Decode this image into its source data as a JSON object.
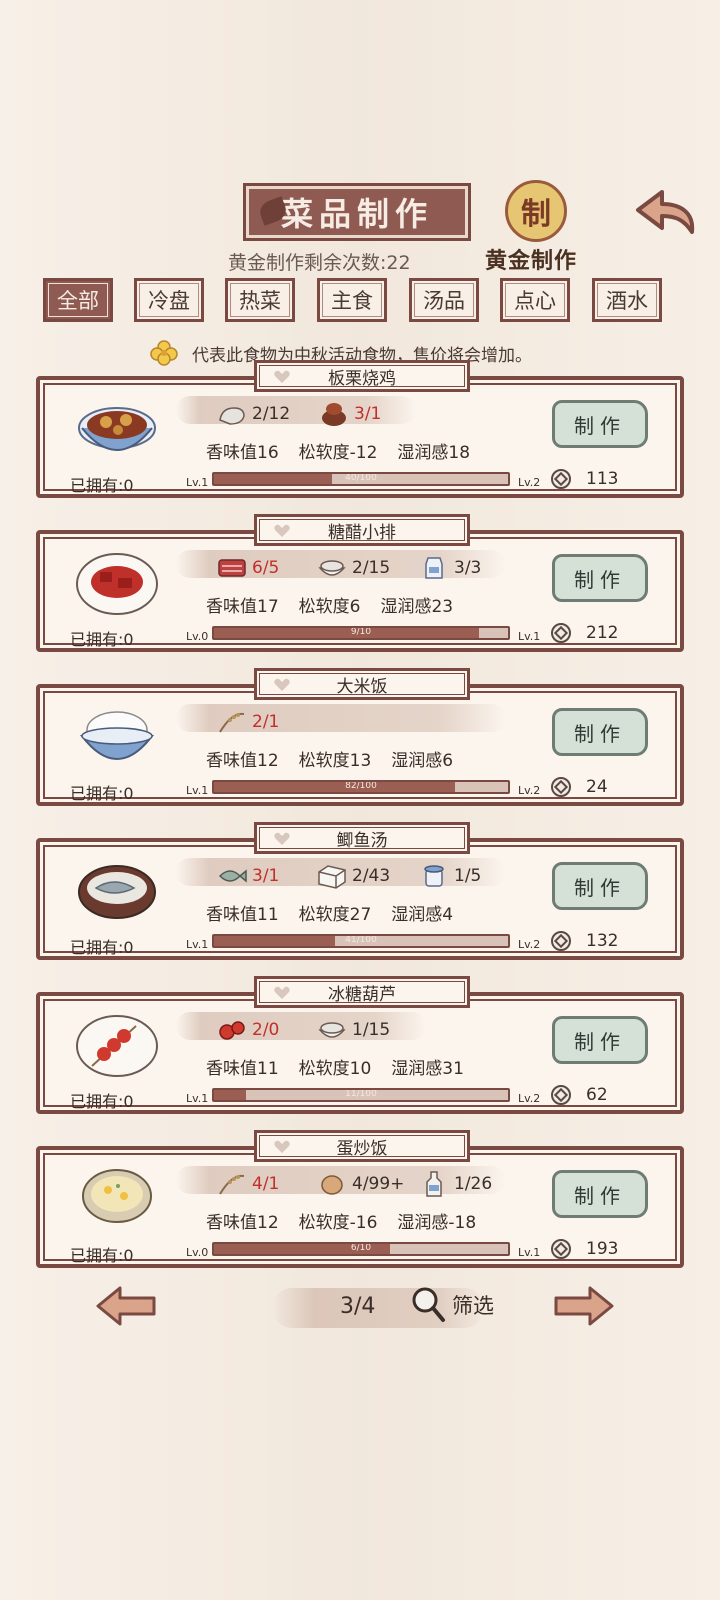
{
  "header": {
    "title": "菜品制作",
    "gold_seal_glyph": "制",
    "gold_label": "黄金制作",
    "remaining": "黄金制作剩余次数:22"
  },
  "tabs": [
    {
      "label": "全部",
      "active": true
    },
    {
      "label": "冷盘",
      "active": false
    },
    {
      "label": "热菜",
      "active": false
    },
    {
      "label": "主食",
      "active": false
    },
    {
      "label": "汤品",
      "active": false
    },
    {
      "label": "点心",
      "active": false
    },
    {
      "label": "酒水",
      "active": false
    }
  ],
  "notice": "代表此食物为中秋活动食物，售价将会增加。",
  "dishes": [
    {
      "name": "板栗烧鸡",
      "owned": "已拥有:0",
      "ingredients": [
        {
          "icon": "chicken-icon",
          "count": "2/12",
          "short": false
        },
        {
          "icon": "chestnut-icon",
          "count": "3/1",
          "short": true
        }
      ],
      "stats": [
        "香味值16",
        "松软度-12",
        "湿润感18"
      ],
      "level_from": "Lv.1",
      "level_to": "Lv.2",
      "progress_text": "40/100",
      "progress": 0.4,
      "make_label": "制作",
      "price": "113"
    },
    {
      "name": "糖醋小排",
      "owned": "已拥有:0",
      "ingredients": [
        {
          "icon": "meat-icon",
          "count": "6/5",
          "short": true
        },
        {
          "icon": "sugar-bowl-icon",
          "count": "2/15",
          "short": false
        },
        {
          "icon": "vinegar-jar-icon",
          "count": "3/3",
          "short": false
        }
      ],
      "stats": [
        "香味值17",
        "松软度6",
        "湿润感23"
      ],
      "level_from": "Lv.0",
      "level_to": "Lv.1",
      "progress_text": "9/10",
      "progress": 0.9,
      "make_label": "制作",
      "price": "212"
    },
    {
      "name": "大米饭",
      "owned": "已拥有:0",
      "ingredients": [
        {
          "icon": "rice-stalk-icon",
          "count": "2/1",
          "short": true
        }
      ],
      "stats": [
        "香味值12",
        "松软度13",
        "湿润感6"
      ],
      "level_from": "Lv.1",
      "level_to": "Lv.2",
      "progress_text": "82/100",
      "progress": 0.82,
      "make_label": "制作",
      "price": "24"
    },
    {
      "name": "鲫鱼汤",
      "owned": "已拥有:0",
      "ingredients": [
        {
          "icon": "fish-icon",
          "count": "3/1",
          "short": true
        },
        {
          "icon": "tofu-icon",
          "count": "2/43",
          "short": false
        },
        {
          "icon": "salt-jar-icon",
          "count": "1/5",
          "short": false
        }
      ],
      "stats": [
        "香味值11",
        "松软度27",
        "湿润感4"
      ],
      "level_from": "Lv.1",
      "level_to": "Lv.2",
      "progress_text": "41/100",
      "progress": 0.41,
      "make_label": "制作",
      "price": "132"
    },
    {
      "name": "冰糖葫芦",
      "owned": "已拥有:0",
      "ingredients": [
        {
          "icon": "hawthorn-icon",
          "count": "2/0",
          "short": true
        },
        {
          "icon": "sugar-bowl-icon",
          "count": "1/15",
          "short": false
        }
      ],
      "stats": [
        "香味值11",
        "松软度10",
        "湿润感31"
      ],
      "level_from": "Lv.1",
      "level_to": "Lv.2",
      "progress_text": "11/100",
      "progress": 0.11,
      "make_label": "制作",
      "price": "62"
    },
    {
      "name": "蛋炒饭",
      "owned": "已拥有:0",
      "ingredients": [
        {
          "icon": "rice-stalk-icon",
          "count": "4/1",
          "short": true
        },
        {
          "icon": "egg-icon",
          "count": "4/99+",
          "short": false
        },
        {
          "icon": "oil-bottle-icon",
          "count": "1/26",
          "short": false
        }
      ],
      "stats": [
        "香味值12",
        "松软度-16",
        "湿润感-18"
      ],
      "level_from": "Lv.0",
      "level_to": "Lv.1",
      "progress_text": "6/10",
      "progress": 0.6,
      "make_label": "制作",
      "price": "193"
    }
  ],
  "footer": {
    "page": "3/4",
    "filter_label": "筛选"
  },
  "colors": {
    "frame": "#7a4a42",
    "accent": "#8e5a52",
    "shortage_red": "#c0302a",
    "make_button": "#d5e1d7"
  }
}
